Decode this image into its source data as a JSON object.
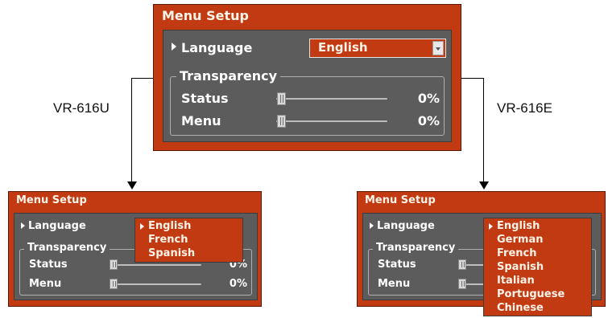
{
  "top_panel": {
    "title": "Menu Setup",
    "language_label": "Language",
    "language_value": "English",
    "transparency_label": "Transparency",
    "rows": [
      {
        "label": "Status",
        "value": "0%",
        "level": 0
      },
      {
        "label": "Menu",
        "value": "0%",
        "level": 0
      }
    ]
  },
  "left_model": "VR-616U",
  "right_model": "VR-616E",
  "left_panel": {
    "title": "Menu Setup",
    "language_label": "Language",
    "transparency_label": "Transparency",
    "rows": [
      {
        "label": "Status",
        "value": "0%",
        "level": 0
      },
      {
        "label": "Menu",
        "value": "0%",
        "level": 0
      }
    ],
    "options": [
      "English",
      "French",
      "Spanish"
    ],
    "selected_option": "English"
  },
  "right_panel": {
    "title": "Menu Setup",
    "language_label": "Language",
    "transparency_label": "Transparency",
    "rows": [
      {
        "label": "Status",
        "level": 0
      },
      {
        "label": "Menu",
        "level": 0
      }
    ],
    "options": [
      "English",
      "German",
      "French",
      "Spanish",
      "Italian",
      "Portuguese",
      "Chinese"
    ],
    "selected_option": "English"
  },
  "colors": {
    "panel": "#c23a12",
    "inner": "#5c5c5c",
    "text": "#ffffff"
  }
}
